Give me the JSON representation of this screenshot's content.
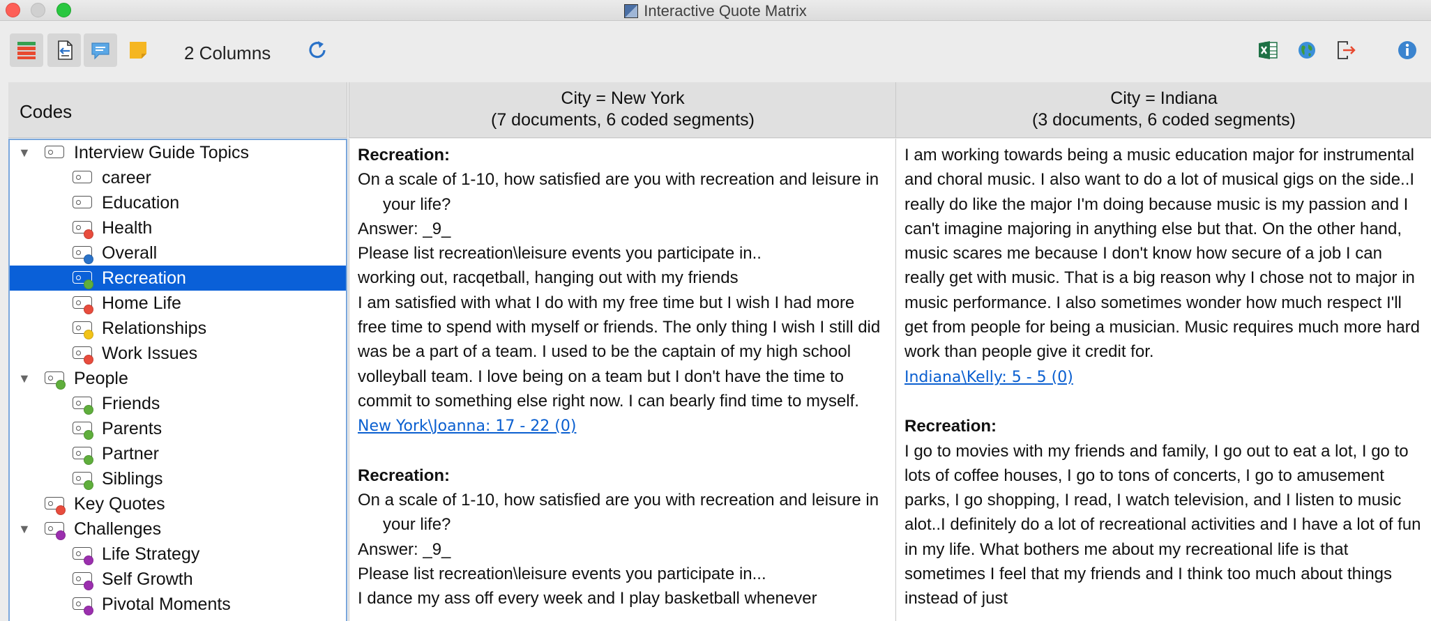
{
  "window": {
    "title": "Interactive Quote Matrix"
  },
  "toolbar": {
    "columns_label": "2 Columns",
    "buttons": [
      {
        "name": "code-list-toggle",
        "icon": "list-icon"
      },
      {
        "name": "import-document",
        "icon": "document-arrow-icon"
      },
      {
        "name": "memo-comments",
        "icon": "speech-bubble-icon"
      },
      {
        "name": "sticky-note",
        "icon": "note-icon"
      },
      {
        "name": "refresh",
        "icon": "refresh-icon"
      },
      {
        "name": "export-excel",
        "icon": "excel-icon"
      },
      {
        "name": "export-web",
        "icon": "globe-icon"
      },
      {
        "name": "export-file",
        "icon": "export-icon"
      },
      {
        "name": "info",
        "icon": "info-icon"
      }
    ]
  },
  "codes": {
    "header": "Codes",
    "items": [
      {
        "label": "Interview Guide Topics",
        "level": 0,
        "expandable": true,
        "color": ""
      },
      {
        "label": "career",
        "level": 1,
        "color": ""
      },
      {
        "label": "Education",
        "level": 1,
        "color": ""
      },
      {
        "label": "Health",
        "level": 1,
        "color": "#e84c3d"
      },
      {
        "label": "Overall",
        "level": 1,
        "color": "#2a72c8"
      },
      {
        "label": "Recreation",
        "level": 1,
        "color": "#5fae3c",
        "selected": true
      },
      {
        "label": "Home Life",
        "level": 1,
        "color": "#e84c3d"
      },
      {
        "label": "Relationships",
        "level": 1,
        "color": "#f2c318"
      },
      {
        "label": "Work Issues",
        "level": 1,
        "color": "#e84c3d"
      },
      {
        "label": "People",
        "level": 0,
        "expandable": true,
        "color": "#5fae3c"
      },
      {
        "label": "Friends",
        "level": 1,
        "color": "#5fae3c"
      },
      {
        "label": "Parents",
        "level": 1,
        "color": "#5fae3c"
      },
      {
        "label": "Partner",
        "level": 1,
        "color": "#5fae3c"
      },
      {
        "label": "Siblings",
        "level": 1,
        "color": "#5fae3c"
      },
      {
        "label": "Key Quotes",
        "level": 0,
        "expandable": false,
        "color": "#e84c3d"
      },
      {
        "label": "Challenges",
        "level": 0,
        "expandable": true,
        "color": "#9b2fae"
      },
      {
        "label": "Life Strategy",
        "level": 1,
        "color": "#9b2fae"
      },
      {
        "label": "Self Growth",
        "level": 1,
        "color": "#9b2fae"
      },
      {
        "label": "Pivotal Moments",
        "level": 1,
        "color": "#9b2fae"
      }
    ]
  },
  "columns": [
    {
      "header_line1": "City = New York",
      "header_line2": "(7 documents, 6 coded segments)",
      "segments": [
        {
          "title": "Recreation:",
          "lines": [
            {
              "text": "On a scale of 1-10, how satisfied are you with recreation and leisure in your life?",
              "hanging": true
            },
            {
              "text": "Answer: _9_"
            },
            {
              "text": "Please list recreation\\leisure events you participate in.."
            },
            {
              "text": "working out, racqetball, hanging out with my friends"
            },
            {
              "text": "I am satisfied with what I do with my free time but I wish I had more free time to spend with myself or friends.  The only thing I wish I still did was be a part of a team.  I used to be the captain of my high school volleyball team.  I love being on a team but I don't have the time to commit to something else right now.  I can bearly find time to myself."
            }
          ],
          "source": "New York\\Joanna: 17 - 22  (0)"
        },
        {
          "title": "Recreation:",
          "lines": [
            {
              "text": "On a scale of 1-10, how satisfied are you with recreation and leisure in your life?",
              "hanging": true
            },
            {
              "text": "Answer: _9_"
            },
            {
              "text": "Please list recreation\\leisure events you participate in..."
            },
            {
              "text": "I dance my ass off every week and I play basketball whenever"
            }
          ],
          "source": ""
        }
      ]
    },
    {
      "header_line1": "City = Indiana",
      "header_line2": "(3 documents, 6 coded segments)",
      "segments": [
        {
          "title": "",
          "lines": [
            {
              "text": "I am working towards being a music education major for instrumental and choral music.  I also want to do a lot of musical gigs on the side..I really do like the major I'm doing because music is my passion and I can't imagine majoring in anything else but that.  On the other hand, music scares me because I don't know how secure of a job I can really get with music.  That is a big reason why I chose not to major in music performance.  I also sometimes wonder how much respect I'll get from people for being a musician.  Music requires much more hard work than people give it credit for."
            }
          ],
          "source": "Indiana\\Kelly: 5 - 5  (0)"
        },
        {
          "title": "Recreation:",
          "lines": [
            {
              "text": "I go to movies with my friends and family, I go out to eat a lot, I go to lots of coffee houses, I go to tons of concerts, I go to amusement parks, I go shopping, I read, I watch television, and I listen to music alot..I definitely do a lot of recreational activities and I have a lot of fun in my life.  What bothers me about my recreational life is that sometimes I feel that my friends and I think too much about things instead of just"
            }
          ],
          "source": ""
        }
      ]
    }
  ]
}
